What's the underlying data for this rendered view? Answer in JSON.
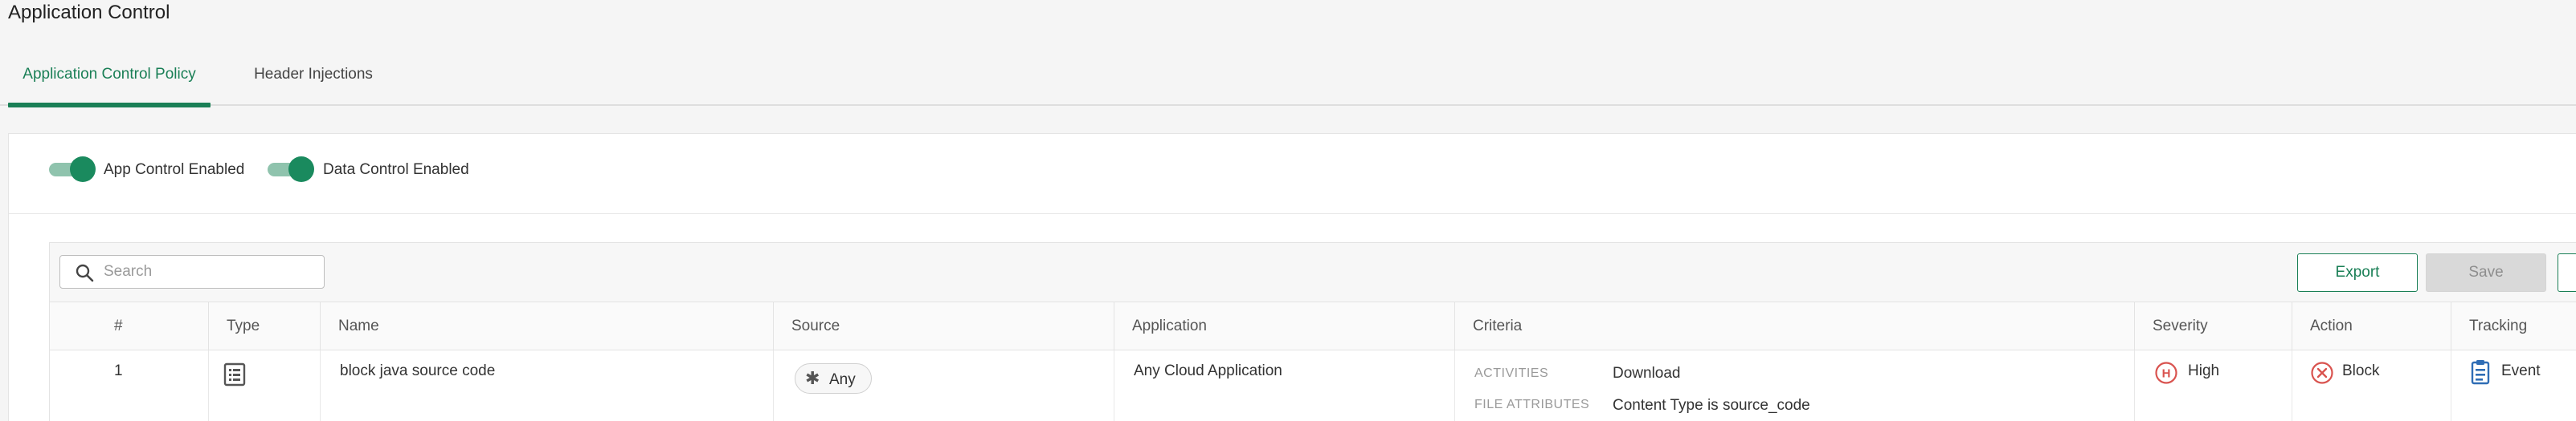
{
  "page": {
    "title": "Application Control"
  },
  "tabs": [
    {
      "label": "Application Control Policy",
      "active": true
    },
    {
      "label": "Header Injections",
      "active": false
    }
  ],
  "toggles": [
    {
      "label": "App Control Enabled",
      "on": true
    },
    {
      "label": "Data Control Enabled",
      "on": true
    }
  ],
  "toolbar": {
    "search_placeholder": "Search",
    "export_label": "Export",
    "save_label": "Save"
  },
  "table": {
    "columns": [
      "#",
      "Type",
      "Name",
      "Source",
      "Application",
      "Criteria",
      "Severity",
      "Action",
      "Tracking"
    ],
    "rows": [
      {
        "index": "1",
        "type_icon": "list-rule-icon",
        "name": "block java source code",
        "source": "Any",
        "application": "Any Cloud Application",
        "criteria": [
          {
            "key": "ACTIVITIES",
            "value": "Download"
          },
          {
            "key": "FILE ATTRIBUTES",
            "value": "Content Type is source_code"
          }
        ],
        "severity": "High",
        "severity_badge": "H",
        "action": "Block",
        "tracking": "Event"
      }
    ]
  },
  "colors": {
    "accent": "#1a7f56",
    "severity_high": "#d9534f",
    "action_block": "#d9534f",
    "tracking_icon": "#2f6db5"
  }
}
